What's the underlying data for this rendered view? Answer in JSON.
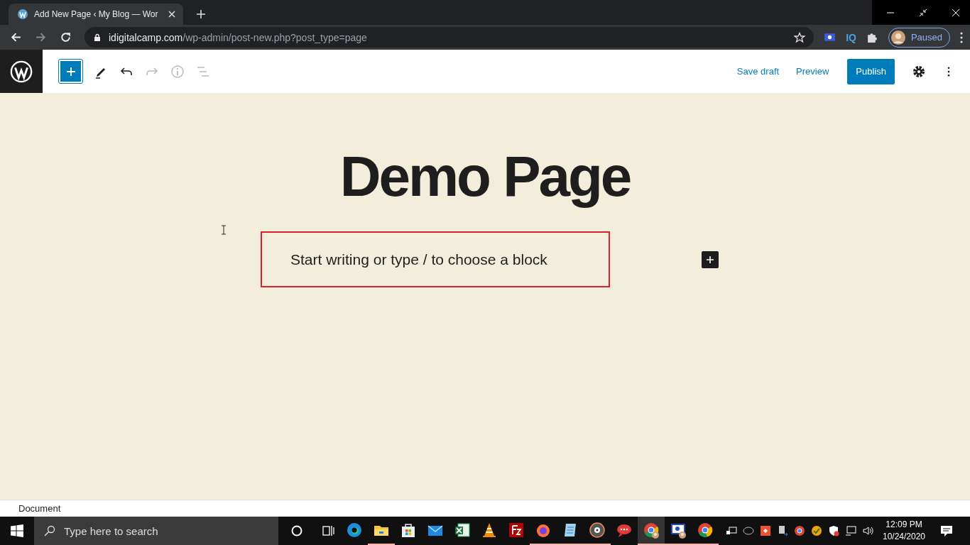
{
  "browser": {
    "tab": {
      "title": "Add New Page ‹ My Blog — Wor"
    },
    "address": {
      "domain": "idigitalcamp.com",
      "path": "/wp-admin/post-new.php?post_type=page"
    },
    "extensions": [
      {
        "kind": "screen"
      },
      {
        "kind": "text",
        "label": "IQ"
      },
      {
        "kind": "puzzle"
      }
    ],
    "profile": {
      "label": "Paused"
    }
  },
  "toolbar": {
    "tools": [
      {
        "kind": "add",
        "disabled": false
      },
      {
        "kind": "edit",
        "disabled": false
      },
      {
        "kind": "undo",
        "disabled": false
      },
      {
        "kind": "redo",
        "disabled": true
      },
      {
        "kind": "info",
        "disabled": true
      },
      {
        "kind": "outline",
        "disabled": true
      }
    ],
    "actions": [
      {
        "kind": "link",
        "label": "Save draft"
      },
      {
        "kind": "link",
        "label": "Preview"
      },
      {
        "kind": "primary",
        "label": "Publish"
      }
    ]
  },
  "title": "Demo Page",
  "block": {
    "placeholder": "Start writing or type / to choose a block"
  },
  "footer": {
    "breadcrumb": "Document"
  },
  "taskbar": {
    "search": {
      "placeholder": "Type here to search"
    },
    "apps": [
      {
        "kind": "edge",
        "running": false,
        "selected": false
      },
      {
        "kind": "folder",
        "running": true,
        "selected": false
      },
      {
        "kind": "store",
        "running": false,
        "selected": false
      },
      {
        "kind": "mail",
        "running": false,
        "selected": false
      },
      {
        "kind": "sheet",
        "running": false,
        "selected": false
      },
      {
        "kind": "cone",
        "running": false,
        "selected": false
      },
      {
        "kind": "ftp",
        "running": false,
        "selected": false
      },
      {
        "kind": "firefox",
        "running": true,
        "selected": false
      },
      {
        "kind": "notepad",
        "running": true,
        "selected": false
      },
      {
        "kind": "disc",
        "running": true,
        "selected": false
      },
      {
        "kind": "chat",
        "running": false,
        "selected": false
      },
      {
        "kind": "chrome-avatar",
        "running": true,
        "selected": true
      },
      {
        "kind": "remote",
        "running": true,
        "selected": false
      },
      {
        "kind": "chrome",
        "running": true,
        "selected": false
      }
    ],
    "clock": {
      "time": "12:09 PM",
      "date": "10/24/2020"
    }
  }
}
